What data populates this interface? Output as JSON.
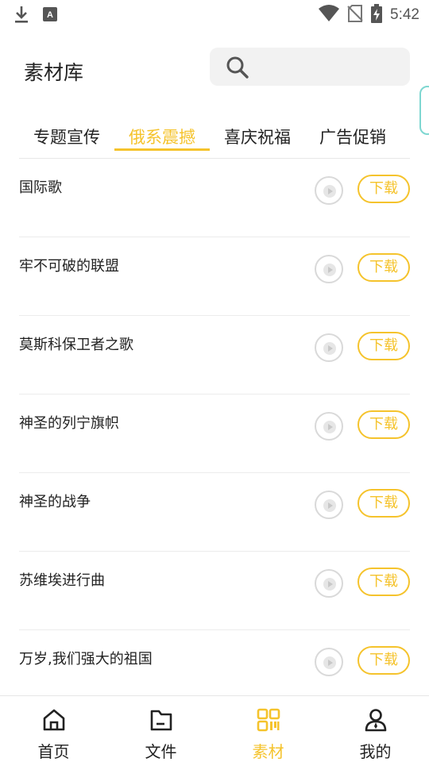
{
  "status_bar": {
    "time": "5:42",
    "icons": [
      "download-icon",
      "keyboard-a-icon",
      "wifi-icon",
      "no-sim-icon",
      "battery-charging-icon"
    ]
  },
  "header": {
    "title": "素材库",
    "search_icon": "search-icon"
  },
  "tabs": [
    {
      "label": "专题宣传",
      "active": false
    },
    {
      "label": "俄系震撼",
      "active": true
    },
    {
      "label": "喜庆祝福",
      "active": false
    },
    {
      "label": "广告促销",
      "active": false
    }
  ],
  "list": {
    "download_label": "下载",
    "items": [
      {
        "title": "国际歌"
      },
      {
        "title": "牢不可破的联盟"
      },
      {
        "title": "莫斯科保卫者之歌"
      },
      {
        "title": "神圣的列宁旗帜"
      },
      {
        "title": "神圣的战争"
      },
      {
        "title": "苏维埃进行曲"
      },
      {
        "title": "万岁,我们强大的祖国"
      }
    ]
  },
  "bottom_nav": [
    {
      "label": "首页",
      "icon": "home-icon",
      "active": false
    },
    {
      "label": "文件",
      "icon": "folder-icon",
      "active": false
    },
    {
      "label": "素材",
      "icon": "qr-code-icon",
      "active": true
    },
    {
      "label": "我的",
      "icon": "user-icon",
      "active": false
    }
  ],
  "colors": {
    "accent": "#f5c32c",
    "divider": "#ececec",
    "search_bg": "#f2f2f2"
  }
}
